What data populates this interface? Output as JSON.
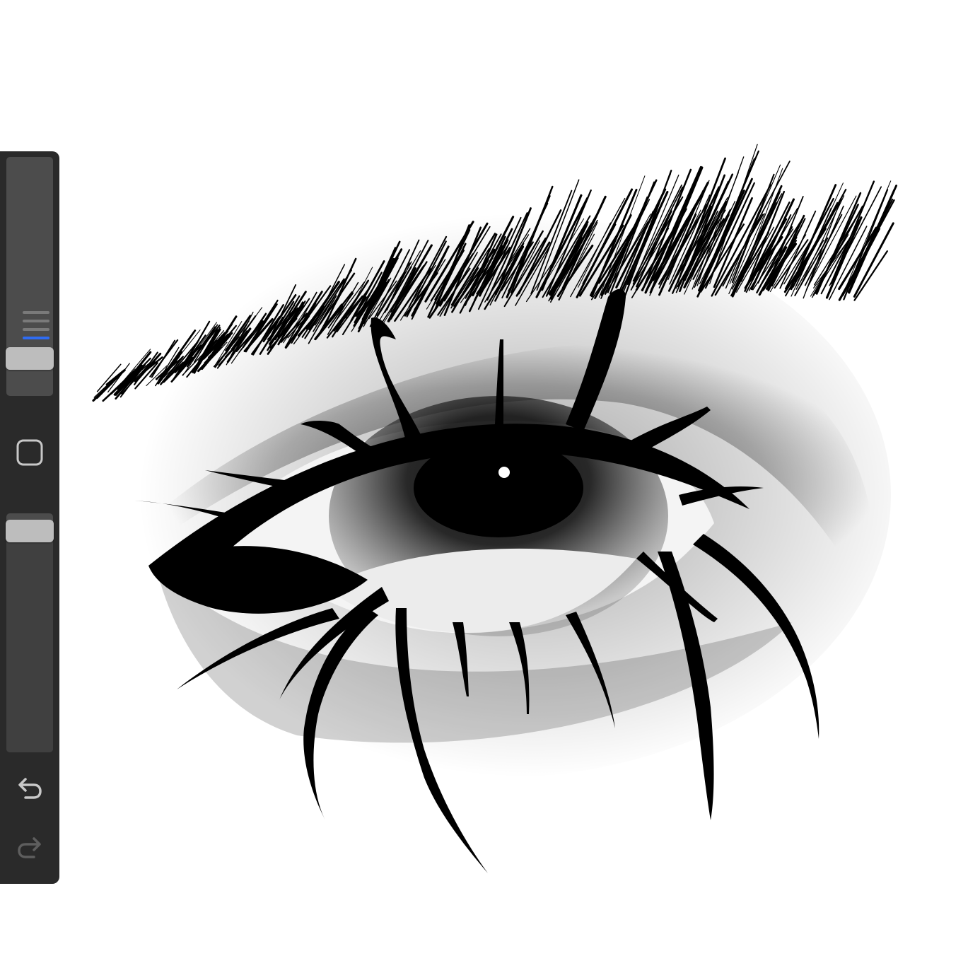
{
  "app": {
    "sidebar": {
      "brush_size": {
        "level": 0.12,
        "selected_preset": 4,
        "preset_count": 4
      },
      "opacity": {
        "level": 0.97
      },
      "modify_button": {
        "icon": "square-icon"
      },
      "undo_button": {
        "icon": "undo-icon"
      },
      "redo_button": {
        "icon": "redo-icon",
        "enabled": false
      }
    },
    "canvas": {
      "artwork": "eye-drawing"
    },
    "colors": {
      "sidebar_bg": "#2a2a2a",
      "slider_track": "#4c4c4c",
      "thumb": "#bdbdbd",
      "accent": "#2f6cf2",
      "icon": "#c8c8c8",
      "icon_disabled": "#5e5e5e",
      "ink": "#000000",
      "paper": "#ffffff"
    }
  }
}
